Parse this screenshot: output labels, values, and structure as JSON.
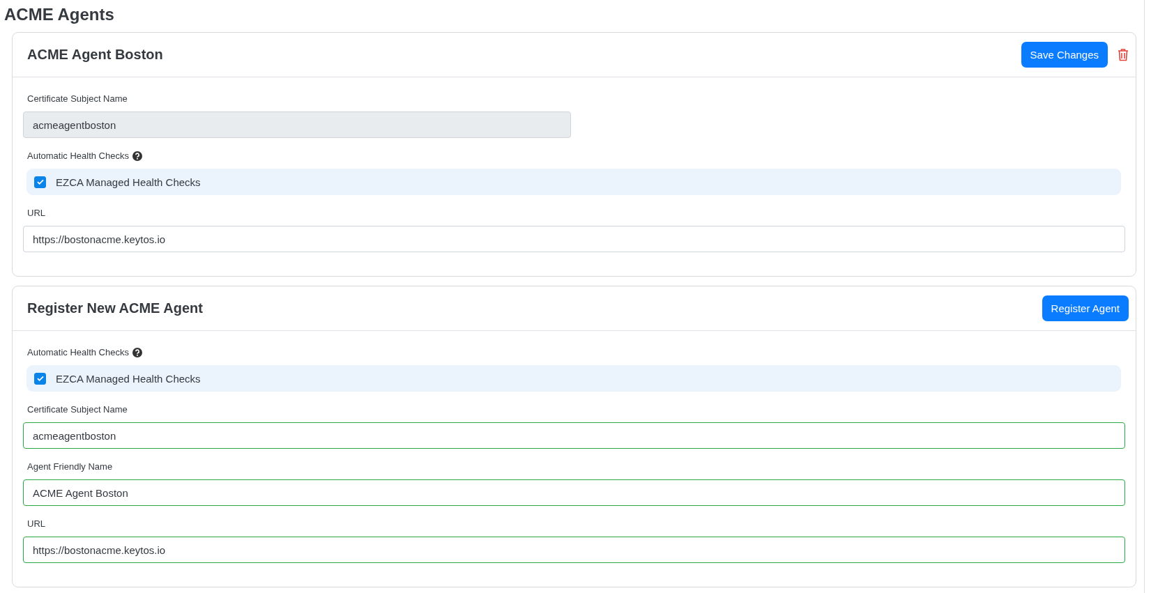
{
  "page_title": "ACME Agents",
  "cards": [
    {
      "title": "ACME Agent Boston",
      "buttons": [
        {
          "label": "Save Changes"
        }
      ],
      "deletable": true,
      "items": [
        {
          "kind": "field",
          "label": "Certificate Subject Name",
          "value": "acmeagentboston",
          "disabled": true,
          "valid": false
        },
        {
          "kind": "checkbox",
          "label": "Automatic Health Checks",
          "help": true,
          "option": "EZCA Managed Health Checks",
          "checked": true
        },
        {
          "kind": "field",
          "label": "URL",
          "value": "https://bostonacme.keytos.io",
          "disabled": false,
          "valid": false
        }
      ]
    },
    {
      "title": "Register New ACME Agent",
      "buttons": [
        {
          "label": "Register Agent"
        }
      ],
      "deletable": false,
      "items": [
        {
          "kind": "checkbox",
          "label": "Automatic Health Checks",
          "help": true,
          "option": "EZCA Managed Health Checks",
          "checked": true
        },
        {
          "kind": "field",
          "label": "Certificate Subject Name",
          "value": "acmeagentboston",
          "disabled": false,
          "valid": true
        },
        {
          "kind": "field",
          "label": "Agent Friendly Name",
          "value": "ACME Agent Boston",
          "disabled": false,
          "valid": true
        },
        {
          "kind": "field",
          "label": "URL",
          "value": "https://bostonacme.keytos.io",
          "disabled": false,
          "valid": true
        }
      ]
    }
  ]
}
